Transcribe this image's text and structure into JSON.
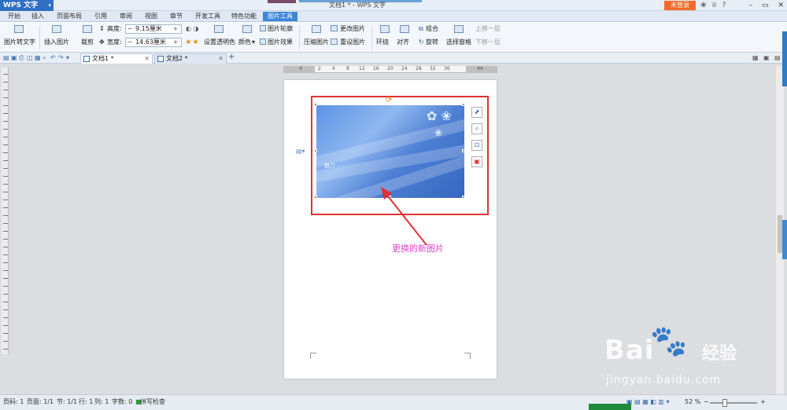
{
  "app": {
    "name": "WPS 文字",
    "title": "文档1 * - WPS 文字",
    "login": "未登录",
    "help": "?"
  },
  "menu": [
    "开始",
    "插入",
    "页面布局",
    "引用",
    "审阅",
    "视图",
    "章节",
    "开发工具",
    "特色功能",
    "图片工具"
  ],
  "ribbon": {
    "img_to_text": "图片转文字",
    "insert_image": "插入图片",
    "crop": "裁剪",
    "height_label": "高度:",
    "height_value": "9.15厘米",
    "width_label": "宽度:",
    "width_value": "14.63厘米",
    "set_transparent": "设置透明色",
    "color": "颜色",
    "img_outline": "图片轮廓",
    "img_effect": "图片效果",
    "compress": "压缩图片",
    "change_img": "更改图片",
    "reset_img": "重设图片",
    "wrap": "环绕",
    "align": "对齐",
    "group": "组合",
    "rotate": "旋转",
    "select_pane": "选择窗格",
    "bring_forward": "上移一层",
    "send_backward": "下移一层"
  },
  "doc_tabs": [
    "文档1 *",
    "文档2 *"
  ],
  "ruler": {
    "numbers": [
      "4",
      "2",
      "4",
      "8",
      "12",
      "16",
      "20",
      "24",
      "28",
      "32",
      "36",
      "44"
    ]
  },
  "picture": {
    "caption": "魅力 -"
  },
  "annotation": "更换的新图片",
  "status": {
    "page_no": "页码: 1",
    "pages": "页面: 1/1",
    "section": "节: 1/1",
    "row": "行: 1",
    "col": "列: 1",
    "words": "字数: 0",
    "spell": "拼写检查",
    "zoom": "52 %"
  },
  "watermark": {
    "brand": "Bai",
    "brand_cn": "经验",
    "url": "jingyan.baidu.com"
  },
  "colors": {
    "accent": "#3d86d8",
    "highlight": "#e03333",
    "annotation": "#e040c8",
    "login": "#f26b2a"
  }
}
